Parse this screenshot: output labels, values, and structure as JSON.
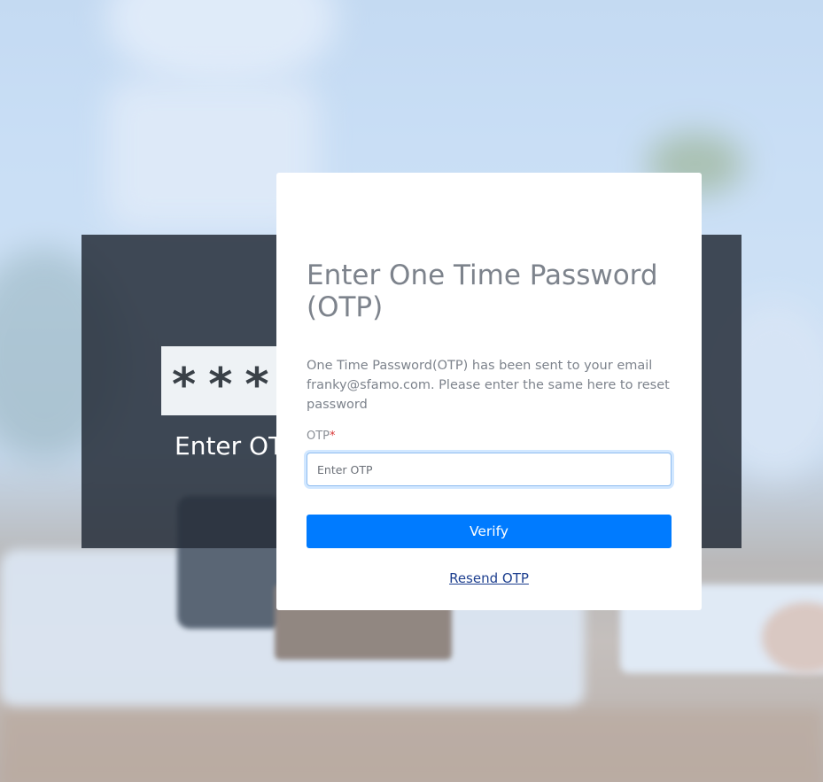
{
  "background": {
    "illustration_stars": [
      "*",
      "*",
      "*"
    ],
    "illustration_caption": "Enter OT"
  },
  "modal": {
    "title": "Enter One Time Password (OTP)",
    "description": "One Time Password(OTP) has been sent to your email franky@sfamo.com. Please enter the same here to reset password",
    "otp_label": "OTP",
    "required_marker": "*",
    "otp_placeholder": "Enter OTP",
    "otp_value": "",
    "verify_label": "Verify",
    "resend_label": "Resend OTP"
  },
  "colors": {
    "primary_button": "#007bff",
    "link": "#1d3f8f",
    "required": "#d93838",
    "text_muted": "#7d838c"
  }
}
